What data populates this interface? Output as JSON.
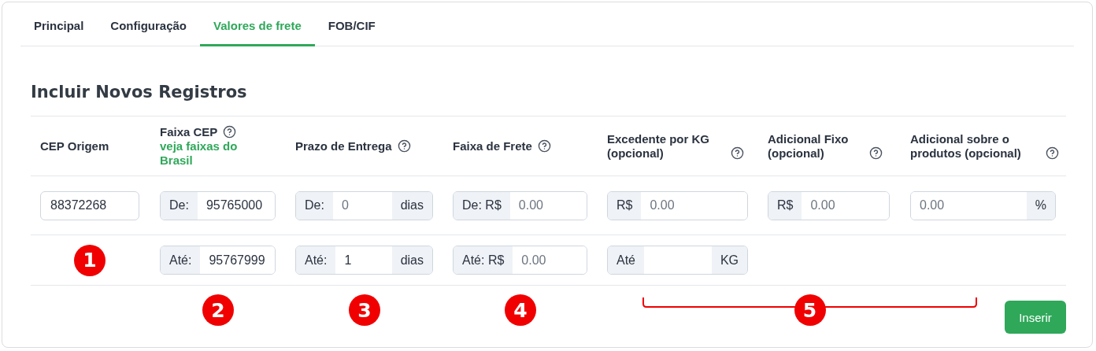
{
  "tabs": [
    {
      "label": "Principal",
      "selected": false
    },
    {
      "label": "Configuração",
      "selected": false
    },
    {
      "label": "Valores de frete",
      "selected": true
    },
    {
      "label": "FOB/CIF",
      "selected": false
    }
  ],
  "heading": "Incluir Novos Registros",
  "columns": [
    {
      "label": "CEP Origem",
      "help": false
    },
    {
      "label": "Faixa CEP",
      "help": true,
      "link": "veja faixas do Brasil"
    },
    {
      "label": "Prazo de Entrega",
      "help": true
    },
    {
      "label": "Faixa de Frete",
      "help": true
    },
    {
      "label": "Excedente por KG (opcional)",
      "help": true
    },
    {
      "label": "Adicional Fixo (opcional)",
      "help": true
    },
    {
      "label": "Adicional sobre o produtos (opcional)",
      "help": true
    }
  ],
  "rows": [
    [
      {
        "kind": "plain",
        "value": "88372268"
      },
      {
        "kind": "group",
        "prefix": "De:",
        "value": "95765000"
      },
      {
        "kind": "group",
        "prefix": "De:",
        "placeholder": "0",
        "suffix": "dias"
      },
      {
        "kind": "group",
        "prefix": "De: R$",
        "placeholder": "0.00"
      },
      {
        "kind": "group",
        "prefix": "R$",
        "placeholder": "0.00"
      },
      {
        "kind": "group",
        "prefix": "R$",
        "placeholder": "0.00"
      },
      {
        "kind": "group",
        "placeholder": "0.00",
        "suffix": "%"
      }
    ],
    [
      {
        "kind": "marker",
        "label": "1"
      },
      {
        "kind": "group",
        "prefix": "Até:",
        "value": "95767999"
      },
      {
        "kind": "group",
        "prefix": "Até:",
        "value": "1",
        "suffix": "dias"
      },
      {
        "kind": "group",
        "prefix": "Até: R$",
        "placeholder": "0.00"
      },
      {
        "kind": "group",
        "prefix": "Até",
        "suffix": "KG"
      },
      {
        "kind": "empty"
      },
      {
        "kind": "empty"
      }
    ]
  ],
  "footer_markers": [
    {
      "label": "2"
    },
    {
      "label": "3"
    },
    {
      "label": "4"
    }
  ],
  "bracket_marker": {
    "label": "5"
  },
  "insert_button": "Inserir"
}
